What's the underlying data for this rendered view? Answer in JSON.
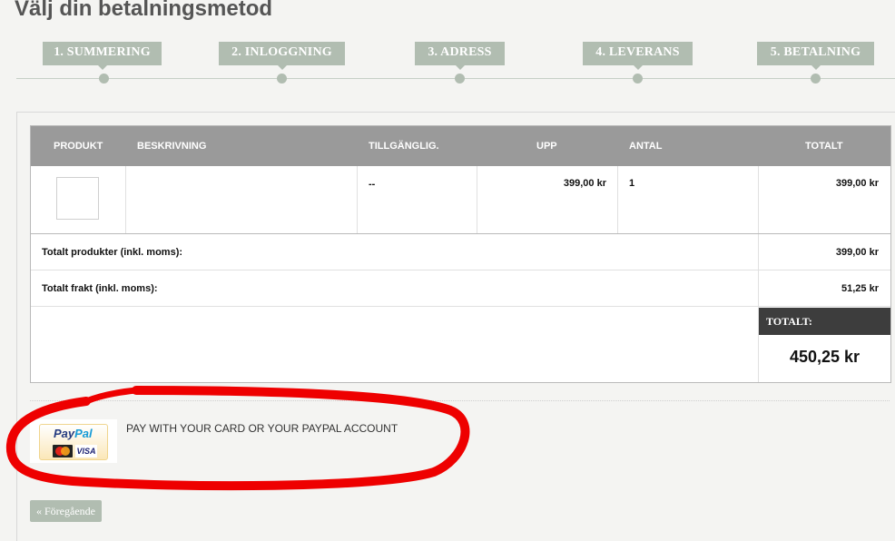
{
  "page": {
    "title": "Välj din betalningsmetod"
  },
  "steps": [
    {
      "label": "1. SUMMERING"
    },
    {
      "label": "2. INLOGGNING"
    },
    {
      "label": "3. ADRESS"
    },
    {
      "label": "4. LEVERANS"
    },
    {
      "label": "5. BETALNING"
    }
  ],
  "cart": {
    "headers": {
      "product": "PRODUKT",
      "description": "BESKRIVNING",
      "availability": "TILLGÄNGLIG.",
      "unit_price": "UPP",
      "quantity": "ANTAL",
      "total": "TOTALT"
    },
    "row": {
      "availability": "--",
      "unit_price": "399,00 kr",
      "quantity": "1",
      "total": "399,00 kr"
    },
    "summary": {
      "products_label": "Totalt produkter (inkl. moms):",
      "products_value": "399,00 kr",
      "shipping_label": "Totalt frakt (inkl. moms):",
      "shipping_value": "51,25 kr",
      "total_label": "TOTALT:",
      "total_value": "450,25 kr"
    }
  },
  "payment": {
    "paypal_word_pay": "Pay",
    "paypal_word_pal": "Pal",
    "visa_text": "VISA",
    "text": "PAY WITH YOUR CARD OR YOUR PAYPAL ACCOUNT"
  },
  "nav": {
    "previous_label": "« Föregående"
  },
  "colors": {
    "step_bg": "#b1bdb1",
    "header_bg": "#9a9a9a",
    "total_bar_bg": "#3d3d3d",
    "annotation_red": "#ee0000"
  }
}
